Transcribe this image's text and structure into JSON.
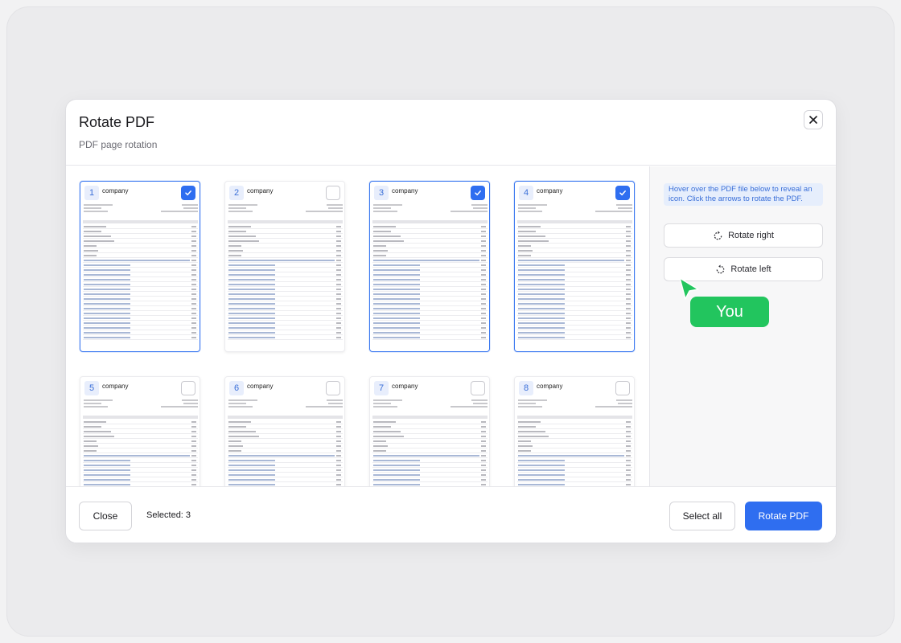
{
  "dialog": {
    "title": "Rotate PDF",
    "subtitle": "PDF page rotation"
  },
  "pages": [
    {
      "number": "1",
      "company": "company",
      "selected": true
    },
    {
      "number": "2",
      "company": "company",
      "selected": false
    },
    {
      "number": "3",
      "company": "company",
      "selected": true
    },
    {
      "number": "4",
      "company": "company",
      "selected": true
    },
    {
      "number": "5",
      "company": "company",
      "selected": false
    },
    {
      "number": "6",
      "company": "company",
      "selected": false
    },
    {
      "number": "7",
      "company": "company",
      "selected": false
    },
    {
      "number": "8",
      "company": "company",
      "selected": false
    }
  ],
  "sidebar": {
    "hint": "Hover over the PDF file below to reveal an icon. Click the arrows to rotate the PDF.",
    "rotate_right_label": "Rotate right",
    "rotate_left_label": "Rotate left"
  },
  "footer": {
    "close_label": "Close",
    "selected_text": "Selected: 3",
    "select_all_label": "Select all",
    "rotate_pdf_label": "Rotate PDF"
  },
  "cursor": {
    "label": "You"
  },
  "colors": {
    "accent": "#2f6ef0",
    "cursor": "#22c55e"
  }
}
